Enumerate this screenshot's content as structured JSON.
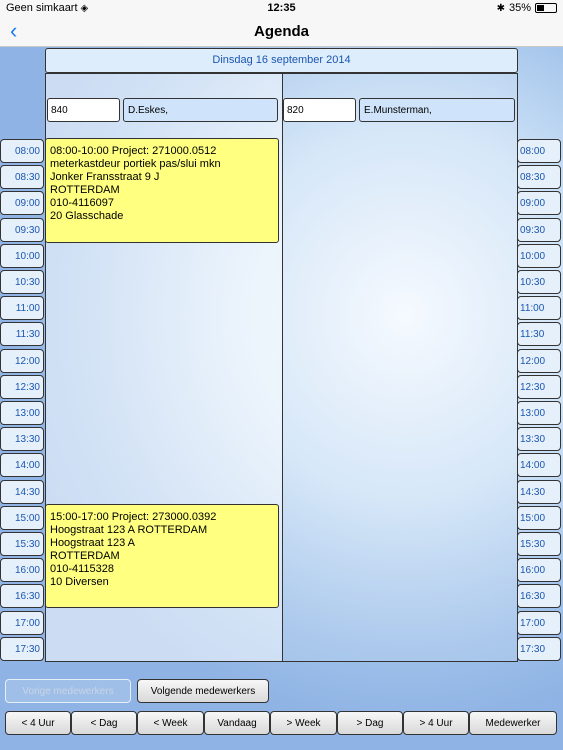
{
  "status": {
    "carrier": "Geen simkaart",
    "time": "12:35",
    "battery": "35%"
  },
  "nav": {
    "title": "Agenda",
    "back_icon": "chevron-left-icon"
  },
  "date": "Dinsdag 16 september 2014",
  "employees": [
    {
      "code": "840",
      "name": "D.Eskes,"
    },
    {
      "code": "820",
      "name": "E.Munsterman,"
    }
  ],
  "times": [
    "08:00",
    "08:30",
    "09:00",
    "09:30",
    "10:00",
    "10:30",
    "11:00",
    "11:30",
    "12:00",
    "12:30",
    "13:00",
    "13:30",
    "14:00",
    "14:30",
    "15:00",
    "15:30",
    "16:00",
    "16:30",
    "17:00",
    "17:30"
  ],
  "appointments": [
    {
      "lines": [
        "08:00-10:00 Project: 271000.0512",
        "meterkastdeur portiek pas/slui mkn",
        "Jonker Fransstraat 9 J",
        "ROTTERDAM",
        "010-4116097",
        "20 Glasschade"
      ]
    },
    {
      "lines": [
        "15:00-17:00 Project: 273000.0392",
        "Hoogstraat 123 A ROTTERDAM",
        "Hoogstraat 123 A",
        "ROTTERDAM",
        "010-4115328",
        "10 Diversen"
      ]
    }
  ],
  "buttons": {
    "prev_employees": "Vorige medewerkers",
    "next_employees": "Volgende medewerkers",
    "nav": [
      "< 4 Uur",
      "< Dag",
      "< Week",
      "Vandaag",
      "> Week",
      "> Dag",
      "> 4 Uur",
      "Medewerker"
    ]
  }
}
